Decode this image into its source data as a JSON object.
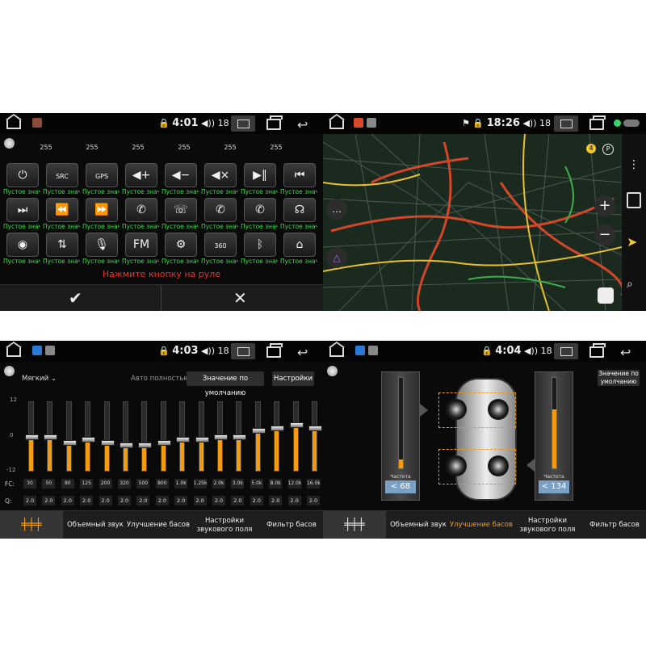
{
  "colors": {
    "accent": "#f39c12",
    "green_label": "#38e04a",
    "hint_red": "#e8322a"
  },
  "screen1": {
    "time": "4:01",
    "volume": "18",
    "values": [
      "255",
      "255",
      "255",
      "255",
      "255",
      "255"
    ],
    "buttons": [
      {
        "icon": "power-icon",
        "glyph": "⏻"
      },
      {
        "icon": "src-icon",
        "glyph": "SRC"
      },
      {
        "icon": "gps-icon",
        "glyph": "GPS"
      },
      {
        "icon": "volume-up-icon",
        "glyph": "◀+"
      },
      {
        "icon": "volume-down-icon",
        "glyph": "◀−"
      },
      {
        "icon": "mute-icon",
        "glyph": "◀×"
      },
      {
        "icon": "play-pause-icon",
        "glyph": "▶∥"
      },
      {
        "icon": "prev-track-icon",
        "glyph": "⏮"
      },
      {
        "icon": "next-track-icon",
        "glyph": "⏭"
      },
      {
        "icon": "rewind-icon",
        "glyph": "⏪"
      },
      {
        "icon": "fast-forward-icon",
        "glyph": "⏩"
      },
      {
        "icon": "phone-answer-icon",
        "glyph": "✆"
      },
      {
        "icon": "phone-hangup-icon",
        "glyph": "☏"
      },
      {
        "icon": "phone-prev-icon",
        "glyph": "✆"
      },
      {
        "icon": "phone-next-icon",
        "glyph": "✆"
      },
      {
        "icon": "voice-icon",
        "glyph": "☊"
      },
      {
        "icon": "camera-icon",
        "glyph": "◉"
      },
      {
        "icon": "audio-icon",
        "glyph": "⇅"
      },
      {
        "icon": "mic-icon",
        "glyph": "🎙"
      },
      {
        "icon": "fm-icon",
        "glyph": "FM"
      },
      {
        "icon": "settings-icon",
        "glyph": "⚙"
      },
      {
        "icon": "camera-360-icon",
        "glyph": "360"
      },
      {
        "icon": "bluetooth-icon",
        "glyph": "ᛒ"
      },
      {
        "icon": "home-icon",
        "glyph": "⌂"
      }
    ],
    "label": "Пустое значение",
    "hint": "Нажмите кнопку на руле"
  },
  "screen2": {
    "time": "18:26",
    "volume": "18",
    "badge": "4",
    "side_p": "P",
    "zoom_in": "+",
    "zoom_out": "−"
  },
  "screen3": {
    "time": "4:03",
    "volume": "18",
    "preset": "Мягкий",
    "auto": "Авто полностью",
    "default_btn": "Значение по умолчанию",
    "settings_btn": "Настройки",
    "scale": [
      "12",
      "0",
      "-12"
    ],
    "fc_label": "FC:",
    "q_label": "Q:",
    "fc": [
      "30",
      "50",
      "80",
      "125",
      "200",
      "320",
      "500",
      "800",
      "1.0k",
      "1.25k",
      "2.0k",
      "3.0k",
      "5.0k",
      "8.0k",
      "12.0k",
      "16.0k"
    ],
    "q": [
      "2.0",
      "2.0",
      "2.0",
      "2.0",
      "2.0",
      "2.0",
      "2.0",
      "2.0",
      "2.0",
      "2.0",
      "2.0",
      "2.0",
      "2.0",
      "2.0",
      "2.0",
      "2.0"
    ],
    "gain": [
      0,
      0,
      -2,
      -1,
      -2,
      -3,
      -3,
      -2,
      -1,
      -1,
      0,
      0,
      2,
      3,
      4,
      3
    ],
    "tabs": [
      "Объемный звук",
      "Улучшение басов",
      "Настройки звукового поля",
      "Фильтр басов"
    ]
  },
  "screen4": {
    "time": "4:04",
    "volume": "18",
    "default_btn": "Значение по умолчанию",
    "freq_label": "Частота",
    "left_value": "68",
    "right_value": "134",
    "left_level": 0.1,
    "right_level": 0.65,
    "tabs": [
      "Объемный звук",
      "Улучшение басов",
      "Настройки звукового поля",
      "Фильтр басов"
    ]
  }
}
